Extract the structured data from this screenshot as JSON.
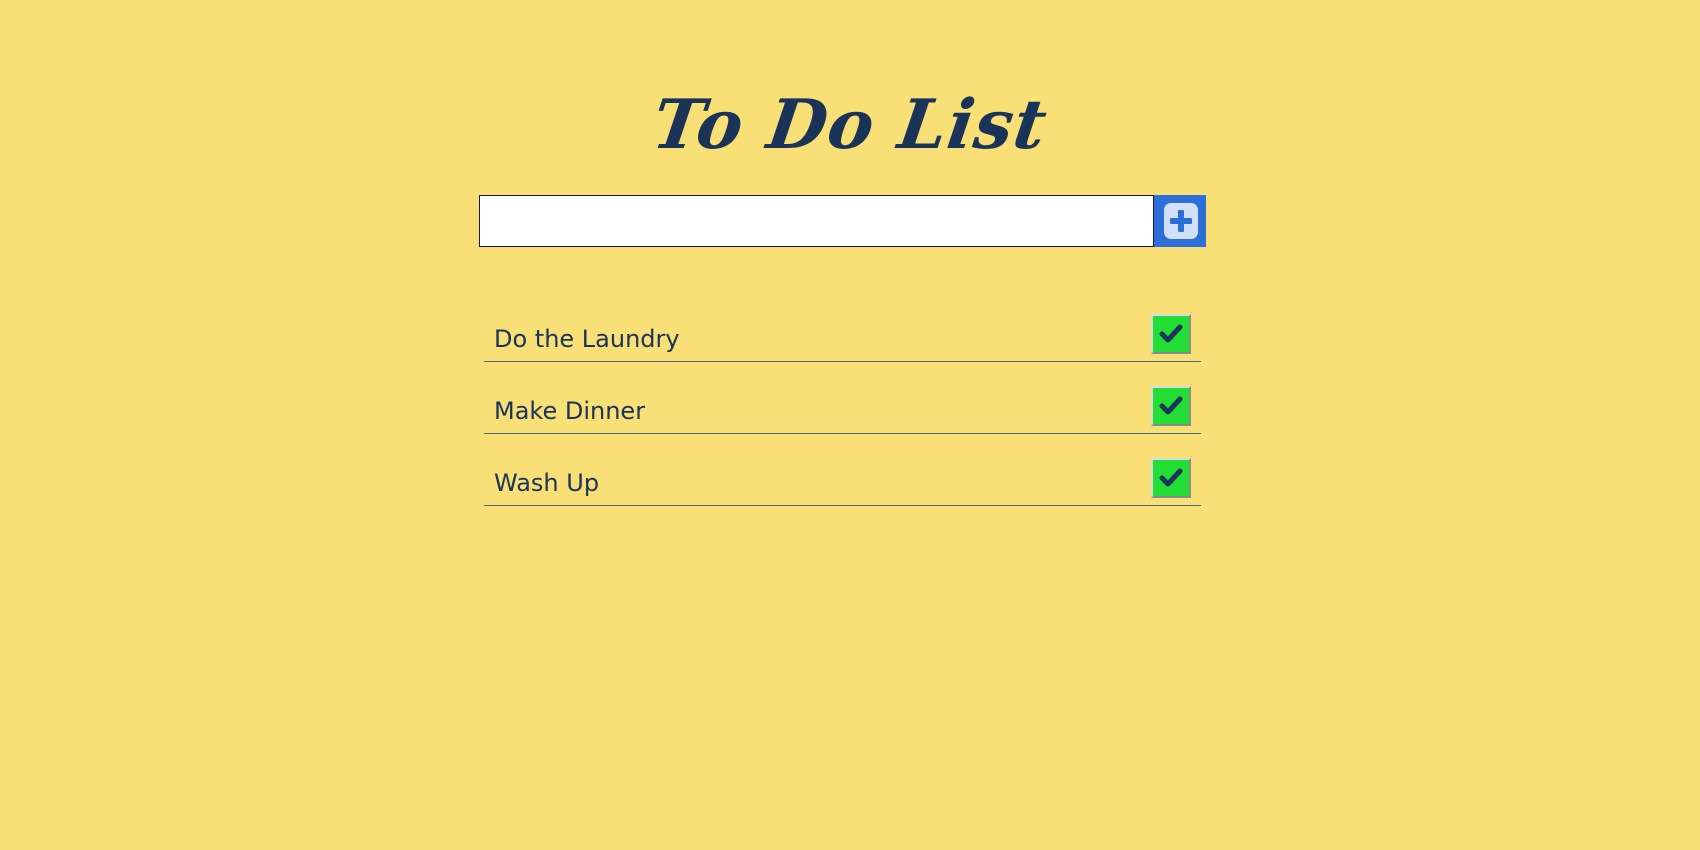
{
  "app": {
    "title": "To Do List"
  },
  "add_form": {
    "input_value": "",
    "input_placeholder": "",
    "add_button_icon": "plus-icon"
  },
  "tasks": [
    {
      "label": "Do the Laundry",
      "done_icon": "checkmark-icon"
    },
    {
      "label": "Make Dinner",
      "done_icon": "checkmark-icon"
    },
    {
      "label": "Wash Up",
      "done_icon": "checkmark-icon"
    }
  ],
  "colors": {
    "background": "#f8e076",
    "text": "#1a3358",
    "accent": "#2d6fd8",
    "done_button": "#22dd33"
  }
}
